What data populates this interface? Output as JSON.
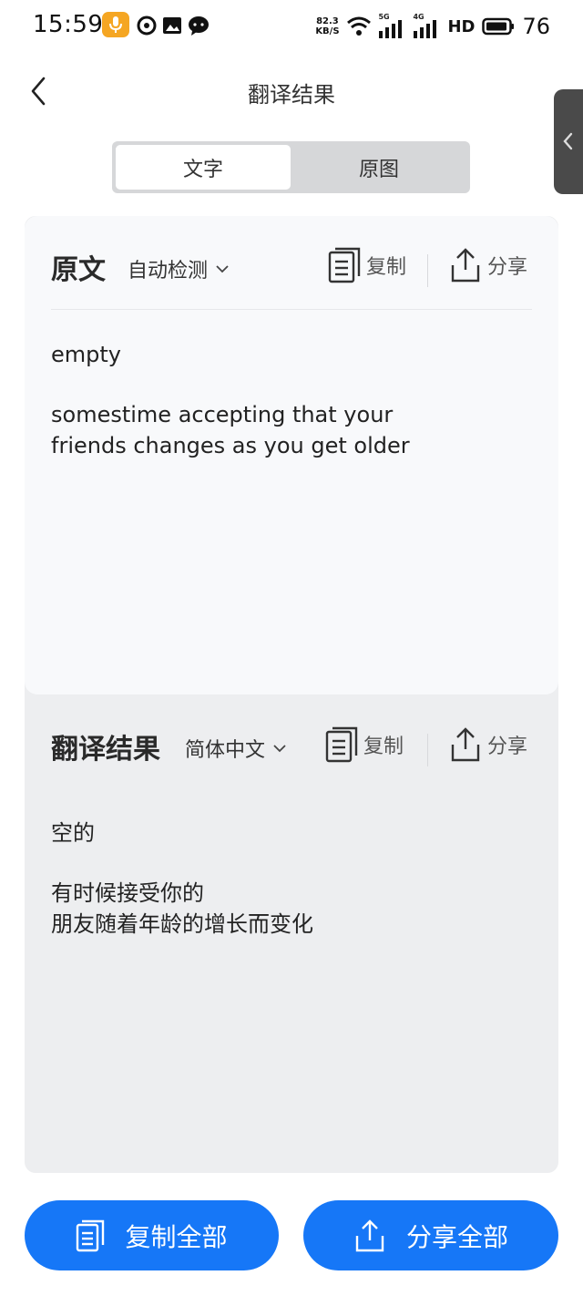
{
  "status_bar": {
    "time": "15:59",
    "net_speed_value": "82.3",
    "net_speed_unit": "KB/S",
    "sig1_label": "5G",
    "sig2_label": "4G",
    "hd_label": "HD",
    "battery": "76"
  },
  "header": {
    "title": "翻译结果"
  },
  "tabs": [
    {
      "label": "文字",
      "active": true
    },
    {
      "label": "原图",
      "active": false
    }
  ],
  "source": {
    "heading": "原文",
    "language": "自动检测",
    "copy_label": "复制",
    "share_label": "分享",
    "text": {
      "line1": "empty",
      "line2": "somestime accepting that your",
      "line3": "friends changes as you get older"
    }
  },
  "translation": {
    "heading": "翻译结果",
    "language": "简体中文",
    "copy_label": "复制",
    "share_label": "分享",
    "text": {
      "line1": "空的",
      "line2": "有时候接受你的",
      "line3": "朋友随着年龄的增长而变化"
    }
  },
  "footer": {
    "copy_all": "复制全部",
    "share_all": "分享全部"
  },
  "colors": {
    "accent": "#1677f7",
    "panel_source_bg": "#f8f9fb",
    "panel_translation_bg": "#edeef0",
    "mic_badge": "#f5a623"
  },
  "icons": [
    "microphone-icon",
    "chat-icon",
    "wifi-icon",
    "signal-icon",
    "battery-icon",
    "back-arrow-icon",
    "side-chevron-icon",
    "chevron-down-icon",
    "copy-icon",
    "share-icon"
  ]
}
